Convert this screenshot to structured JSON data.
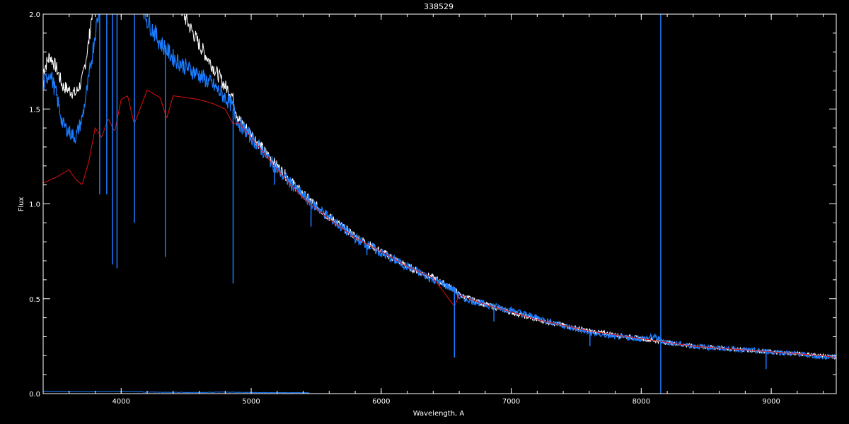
{
  "chart_data": {
    "type": "line",
    "title": "338529",
    "xlabel": "Wavelength, A",
    "ylabel": "Flux",
    "xlim": [
      3400,
      9500
    ],
    "ylim": [
      0.0,
      2.0
    ],
    "grid": false,
    "x_ticks": [
      4000,
      5000,
      6000,
      7000,
      8000,
      9000
    ],
    "x_tick_labels": [
      "4000",
      "5000",
      "6000",
      "7000",
      "8000",
      "9000"
    ],
    "y_ticks": [
      0.0,
      0.5,
      1.0,
      1.5,
      2.0
    ],
    "y_tick_labels": [
      "0.0",
      "0.5",
      "1.0",
      "1.5",
      "2.0"
    ],
    "colors": {
      "background": "#000000",
      "axes": "#ffffff",
      "white_series": "#ffffff",
      "blue_series": "#1a7cff",
      "red_series": "#e01010",
      "error_series": "#1a7cff"
    },
    "series": [
      {
        "color_key": "white_series",
        "x": [
          3400,
          3450,
          3500,
          3550,
          3600,
          3650,
          3700,
          3750,
          3800,
          3900,
          4000,
          4100,
          4200,
          4300,
          4400,
          4500,
          4600,
          4700,
          4800,
          4850,
          4900,
          5000,
          5100,
          5200,
          5400,
          5600,
          5800,
          6000,
          6200,
          6400,
          6560,
          6600,
          6800,
          7000,
          7200,
          7400,
          7600,
          7800,
          8000,
          8200,
          8400,
          8600,
          8800,
          9000,
          9200,
          9400,
          9500
        ],
        "y": [
          1.7,
          1.78,
          1.72,
          1.62,
          1.6,
          1.58,
          1.65,
          1.85,
          2.15,
          2.6,
          2.8,
          2.75,
          2.55,
          2.3,
          2.12,
          1.97,
          1.84,
          1.73,
          1.62,
          1.58,
          1.45,
          1.37,
          1.28,
          1.2,
          1.05,
          0.93,
          0.83,
          0.75,
          0.67,
          0.61,
          0.55,
          0.52,
          0.47,
          0.43,
          0.39,
          0.36,
          0.33,
          0.31,
          0.29,
          0.27,
          0.25,
          0.24,
          0.23,
          0.22,
          0.21,
          0.2,
          0.19
        ]
      },
      {
        "color_key": "blue_series",
        "x": [
          3400,
          3450,
          3500,
          3550,
          3600,
          3650,
          3700,
          3750,
          3800,
          3900,
          4000,
          4100,
          4200,
          4300,
          4400,
          4500,
          4600,
          4700,
          4800,
          4850,
          4900,
          5000,
          5100,
          5200,
          5400,
          5600,
          5800,
          6000,
          6200,
          6400,
          6560,
          6600,
          6800,
          7000,
          7200,
          7400,
          7600,
          7800,
          8000,
          8100,
          8200,
          8400,
          8600,
          8800,
          9000,
          9200,
          9400,
          9500
        ],
        "y": [
          1.62,
          1.7,
          1.58,
          1.42,
          1.38,
          1.35,
          1.45,
          1.65,
          1.9,
          2.3,
          2.4,
          2.2,
          1.97,
          1.85,
          1.77,
          1.72,
          1.68,
          1.63,
          1.56,
          1.52,
          1.43,
          1.35,
          1.27,
          1.18,
          1.04,
          0.93,
          0.82,
          0.74,
          0.67,
          0.6,
          0.55,
          0.51,
          0.47,
          0.44,
          0.4,
          0.36,
          0.32,
          0.3,
          0.29,
          0.3,
          0.27,
          0.25,
          0.24,
          0.23,
          0.22,
          0.21,
          0.19,
          0.2
        ]
      },
      {
        "color_key": "red_series",
        "x": [
          3400,
          3500,
          3600,
          3650,
          3700,
          3750,
          3800,
          3850,
          3900,
          3950,
          4000,
          4050,
          4100,
          4200,
          4300,
          4350,
          4400,
          4500,
          4600,
          4700,
          4800,
          4861,
          4900,
          5000,
          5200,
          5400,
          5600,
          5800,
          6000,
          6200,
          6400,
          6563,
          6600,
          6800,
          7000,
          7200,
          7400,
          7600,
          7800,
          8000,
          8200,
          8400,
          8600,
          8800,
          9000,
          9200,
          9400,
          9500
        ],
        "y": [
          1.11,
          1.14,
          1.18,
          1.13,
          1.1,
          1.22,
          1.4,
          1.35,
          1.45,
          1.38,
          1.55,
          1.57,
          1.42,
          1.6,
          1.56,
          1.45,
          1.57,
          1.56,
          1.55,
          1.53,
          1.5,
          1.42,
          1.43,
          1.35,
          1.18,
          1.03,
          0.92,
          0.82,
          0.75,
          0.67,
          0.61,
          0.46,
          0.52,
          0.47,
          0.43,
          0.39,
          0.36,
          0.33,
          0.31,
          0.29,
          0.27,
          0.25,
          0.24,
          0.23,
          0.22,
          0.21,
          0.2,
          0.19
        ]
      },
      {
        "color_key": "error_series",
        "x": [
          3400,
          3600,
          3800,
          4000,
          4200,
          4400,
          4600,
          4800,
          5000,
          5200,
          5400,
          5450
        ],
        "y": [
          0.012,
          0.01,
          0.01,
          0.012,
          0.008,
          0.007,
          0.006,
          0.008,
          0.006,
          0.005,
          0.005,
          0.005
        ]
      }
    ],
    "absorption_lines": [
      {
        "x": 3835,
        "y": 1.05
      },
      {
        "x": 3889,
        "y": 1.05
      },
      {
        "x": 3934,
        "y": 0.68
      },
      {
        "x": 3968,
        "y": 0.66
      },
      {
        "x": 4102,
        "y": 0.9
      },
      {
        "x": 4340,
        "y": 0.72
      },
      {
        "x": 4861,
        "y": 0.58
      },
      {
        "x": 5180,
        "y": 1.1
      },
      {
        "x": 5460,
        "y": 0.88
      },
      {
        "x": 5890,
        "y": 0.73
      },
      {
        "x": 6563,
        "y": 0.19
      },
      {
        "x": 6867,
        "y": 0.38
      },
      {
        "x": 7605,
        "y": 0.25
      },
      {
        "x": 8960,
        "y": 0.13
      }
    ],
    "spike": {
      "x": 8150,
      "y_top": 2.0,
      "y_bottom": 0.0
    }
  }
}
